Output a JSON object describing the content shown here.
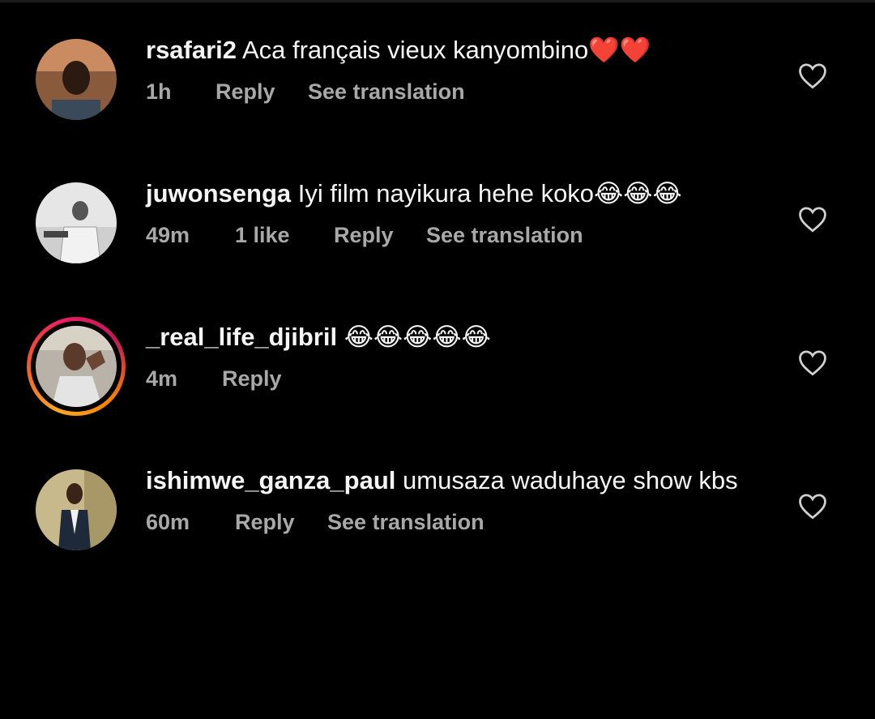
{
  "comments": [
    {
      "username": "rsafari2",
      "text": "Aca français vieux kanyombino",
      "emojis": "❤️❤️",
      "time": "1h",
      "likes": "",
      "reply": "Reply",
      "translate": "See translation",
      "has_story_ring": false
    },
    {
      "username": "juwonsenga",
      "text": "Iyi film nayikura hehe koko",
      "emojis": "😂😂😂",
      "time": "49m",
      "likes": "1 like",
      "reply": "Reply",
      "translate": "See translation",
      "has_story_ring": false
    },
    {
      "username": "_real_life_djibril",
      "text": "",
      "emojis": "😂😂😂😂😂",
      "time": "4m",
      "likes": "",
      "reply": "Reply",
      "translate": "",
      "has_story_ring": true
    },
    {
      "username": "ishimwe_ganza_paul",
      "text": "umusaza waduhaye show kbs",
      "emojis": "",
      "time": "60m",
      "likes": "",
      "reply": "Reply",
      "translate": "See translation",
      "has_story_ring": false
    }
  ],
  "icons": {
    "like": "heart-outline-icon"
  },
  "colors": {
    "background": "#000000",
    "text": "#f5f5f5",
    "meta": "#a8a8a8"
  }
}
